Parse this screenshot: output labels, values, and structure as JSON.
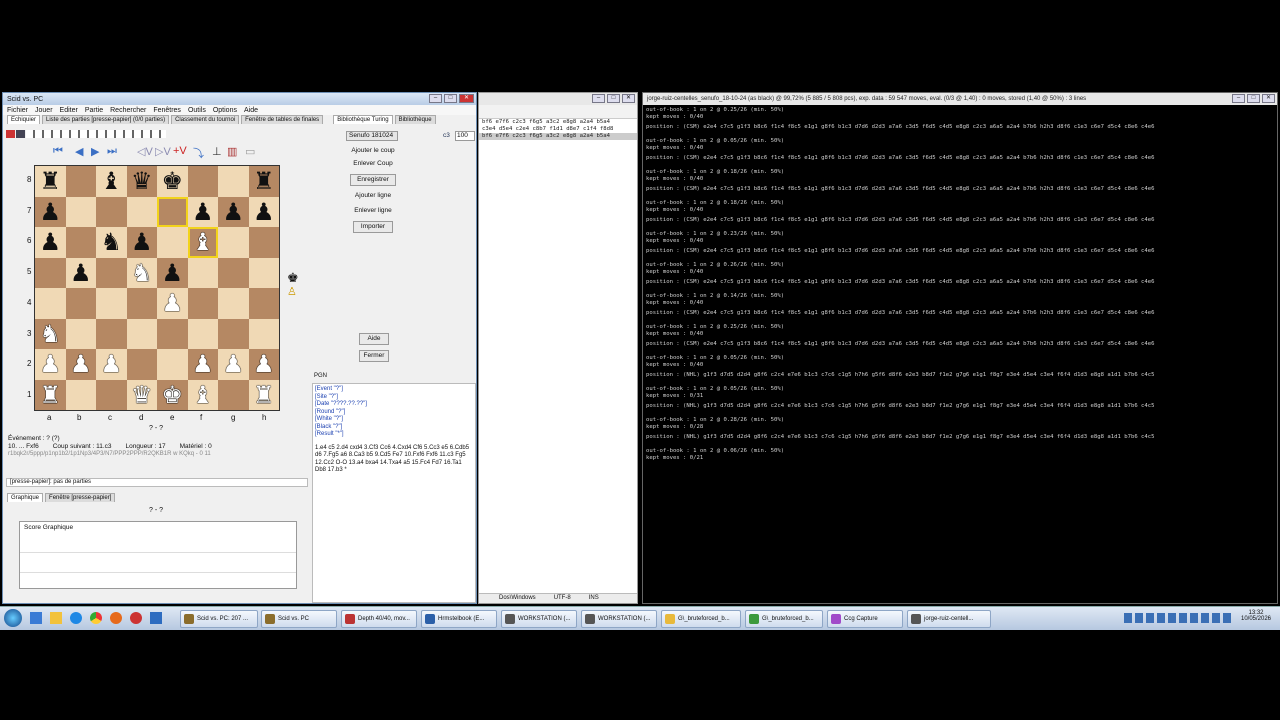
{
  "scid": {
    "title": "Scid vs. PC",
    "menu": [
      "Fichier",
      "Jouer",
      "Editer",
      "Partie",
      "Rechercher",
      "Fenêtres",
      "Outils",
      "Options",
      "Aide"
    ],
    "tabs": [
      "Echiquier",
      "Liste des parties [presse-papier] (0/0 parties)",
      "Classement du tournoi",
      "Fenêtre de tables de finales"
    ],
    "right_tabs": [
      "Bibliothèque Turing",
      "Bibliothèque"
    ],
    "book_select": "Senufo 181024",
    "spin_value": "c3",
    "spin_value2": "100",
    "buttons": {
      "add_move": "Ajouter le coup",
      "remove_move": "Enlever Coup",
      "save": "Enregistrer",
      "add_line": "Ajouter ligne",
      "remove_line": "Enlever ligne",
      "import": "Importer",
      "help": "Aide",
      "close": "Fermer"
    },
    "files": [
      "a",
      "b",
      "c",
      "d",
      "e",
      "f",
      "g",
      "h"
    ],
    "ranks": [
      "8",
      "7",
      "6",
      "5",
      "4",
      "3",
      "2",
      "1"
    ],
    "board": [
      [
        "br",
        "",
        "bb",
        "bq",
        "bk",
        "",
        "",
        "br"
      ],
      [
        "bp",
        "",
        "",
        "",
        "",
        "bp",
        "bp",
        "bp"
      ],
      [
        "bp",
        "",
        "bn",
        "bp",
        "",
        "wb",
        "",
        ""
      ],
      [
        "",
        "bp",
        "",
        "wn",
        "bp",
        "",
        "",
        ""
      ],
      [
        "",
        "",
        "",
        "",
        "wp",
        "",
        "",
        ""
      ],
      [
        "wn",
        "",
        "",
        "",
        "",
        "",
        "",
        ""
      ],
      [
        "wp",
        "wp",
        "wp",
        "",
        "",
        "wp",
        "wp",
        "wp"
      ],
      [
        "wr",
        "",
        "",
        "wq",
        "wk",
        "wb",
        "",
        "wr"
      ]
    ],
    "result_line": "? - ?",
    "info": {
      "event": "Événement : ?  (?)",
      "move": "10. ... Fxf6",
      "next_move": "Coup suivant : 11.c3",
      "length": "Longueur : 17",
      "material": "Matériel : 0",
      "fen": "r1bqk2r/5ppp/p1np1b2/1p1Np3/4P3/N7/PPP2PPP/R2QKB1R w KQkq - 0 11"
    },
    "clipboard": "[presse-papier]: pas de parties",
    "bottom_tabs": [
      "Graphique",
      "Fenêtre [presse-papier]"
    ],
    "graph_result": "? - ?",
    "graph_title": "Score Graphique",
    "pgn_tab": "PGN",
    "pgn_tags": [
      "[Event \"?\"]",
      "[Site \"?\"]",
      "[Date \"????.??.??\"]",
      "[Round \"?\"]",
      "[White \"?\"]",
      "[Black \"?\"]",
      "[Result \"*\"]"
    ],
    "pgn_moves": "1.e4 c5 2.d4 cxd4 3.Cf3 Cc6 4.Cxd4 Cf6 5.Cc3 e5 6.Cdb5 d6 7.Fg5 a6 8.Ca3 b5 9.Cd5 Fe7 10.Fxf6 Fxf6 11.c3 Fg5 12.Cc2 O-O 13.a4 bxa4 14.Txa4 a5 15.Fc4 Fd7 16.Ta1 Db8 17.b3 *"
  },
  "middle": {
    "lines": [
      "bf6 e7f6 c2c3 f6g5 a3c2 e8g8 a2a4 b5a4",
      "c3e4 d5e4 c2e4 c8b7 f1d1 d8e7 c1f4 f8d8",
      "bf6 e7f6 c2c3 f6g5 a3c2 e8g8 a2a4 b5a4"
    ],
    "status": [
      "Dos\\Windows",
      "UTF-8",
      "INS"
    ]
  },
  "console": {
    "title": "jorge-ruiz-centelles_senufo_18-10-24 (as black) @ 99,72% (5 885 / 5 808 pcs), exp. data : 59 547 moves, eval. (0/3 @ 1,40) : 0 moves, stored (1,40 @ 50%) : 3 lines",
    "lines": [
      "out-of-book : 1 on 2 @ 0.25/26 (min. 50%)",
      "kept moves : 0/40",
      "position    : (CSM) e2e4 c7c5 g1f3 b8c6 f1c4 f8c5 e1g1 g8f6 b1c3 d7d6 d2d3 a7a6 c3d5 f6d5 c4d5 e8g8 c2c3 a6a5 a2a4 b7b6 h2h3 d8f6 c1e3 c6e7 d5c4 c8e6 c4e6",
      "out-of-book : 1 on 2 @ 0.05/26 (min. 50%)",
      "kept moves : 0/40",
      "position    : (CSM) e2e4 c7c5 g1f3 b8c6 f1c4 f8c5 e1g1 g8f6 b1c3 d7d6 d2d3 a7a6 c3d5 f6d5 c4d5 e8g8 c2c3 a6a5 a2a4 b7b6 h2h3 d8f6 c1e3 c6e7 d5c4 c8e6 c4e6",
      "out-of-book : 1 on 2 @ 0.18/26 (min. 50%)",
      "kept moves : 0/40",
      "position    : (CSM) e2e4 c7c5 g1f3 b8c6 f1c4 f8c5 e1g1 g8f6 b1c3 d7d6 d2d3 a7a6 c3d5 f6d5 c4d5 e8g8 c2c3 a6a5 a2a4 b7b6 h2h3 d8f6 c1e3 c6e7 d5c4 c8e6 c4e6",
      "out-of-book : 1 on 2 @ 0.18/26 (min. 50%)",
      "kept moves : 0/40",
      "position    : (CSM) e2e4 c7c5 g1f3 b8c6 f1c4 f8c5 e1g1 g8f6 b1c3 d7d6 d2d3 a7a6 c3d5 f6d5 c4d5 e8g8 c2c3 a6a5 a2a4 b7b6 h2h3 d8f6 c1e3 c6e7 d5c4 c8e6 c4e6",
      "out-of-book : 1 on 2 @ 0.23/26 (min. 50%)",
      "kept moves : 0/40",
      "position    : (CSM) e2e4 c7c5 g1f3 b8c6 f1c4 f8c5 e1g1 g8f6 b1c3 d7d6 d2d3 a7a6 c3d5 f6d5 c4d5 e8g8 c2c3 a6a5 a2a4 b7b6 h2h3 d8f6 c1e3 c6e7 d5c4 c8e6 c4e6",
      "out-of-book : 1 on 2 @ 0.26/26 (min. 50%)",
      "kept moves : 0/40",
      "position    : (CSM) e2e4 c7c5 g1f3 b8c6 f1c4 f8c5 e1g1 g8f6 b1c3 d7d6 d2d3 a7a6 c3d5 f6d5 c4d5 e8g8 c2c3 a6a5 a2a4 b7b6 h2h3 d8f6 c1e3 c6e7 d5c4 c8e6 c4e6",
      "out-of-book : 1 on 2 @ 0.14/26 (min. 50%)",
      "kept moves : 0/40",
      "position    : (CSM) e2e4 c7c5 g1f3 b8c6 f1c4 f8c5 e1g1 g8f6 b1c3 d7d6 d2d3 a7a6 c3d5 f6d5 c4d5 e8g8 c2c3 a6a5 a2a4 b7b6 h2h3 d8f6 c1e3 c6e7 d5c4 c8e6 c4e6",
      "out-of-book : 1 on 2 @ 0.25/26 (min. 50%)",
      "kept moves : 0/40",
      "position    : (CSM) e2e4 c7c5 g1f3 b8c6 f1c4 f8c5 e1g1 g8f6 b1c3 d7d6 d2d3 a7a6 c3d5 f6d5 c4d5 e8g8 c2c3 a6a5 a2a4 b7b6 h2h3 d8f6 c1e3 c6e7 d5c4 c8e6 c4e6",
      "out-of-book : 1 on 2 @ 0.05/26 (min. 50%)",
      "kept moves : 0/40",
      "position    : (NHL) g1f3 d7d5 d2d4 g8f6 c2c4 e7e6 b1c3 c7c6 c1g5 h7h6 g5f6 d8f6 e2e3 b8d7 f1e2 g7g6 e1g1 f8g7 e3e4 d5e4 c3e4 f6f4 d1d3 e8g8 a1d1 b7b6 c4c5",
      "out-of-book : 1 on 2 @ 0.05/26 (min. 50%)",
      "kept moves : 0/31",
      "position    : (NHL) g1f3 d7d5 d2d4 g8f6 c2c4 e7e6 b1c3 c7c6 c1g5 h7h6 g5f6 d8f6 e2e3 b8d7 f1e2 g7g6 e1g1 f8g7 e3e4 d5e4 c3e4 f6f4 d1d3 e8g8 a1d1 b7b6 c4c5",
      "out-of-book : 1 on 2 @ 0.28/26 (min. 50%)",
      "kept moves : 0/28",
      "position    : (NHL) g1f3 d7d5 d2d4 g8f6 c2c4 e7e6 b1c3 c7c6 c1g5 h7h6 g5f6 d8f6 e2e3 b8d7 f1e2 g7g6 e1g1 f8g7 e3e4 d5e4 c3e4 f6f4 d1d3 e8g8 a1d1 b7b6 c4c5",
      "out-of-book : 1 on 2 @ 0.06/26 (min. 50%)",
      "kept moves : 0/21"
    ]
  },
  "taskbar": {
    "items": [
      "Scid vs. PC: 207 ...",
      "Scid vs. PC",
      "Depth 40/40, mov...",
      "Hrmstelbook (E...",
      "WORKSTATION (...",
      "WORKSTATION (...",
      "G\\_bruteforced_b...",
      "G\\_bruteforced_b...",
      "Ccg Capture",
      "jorge-ruiz-centell..."
    ],
    "time": "13:32",
    "date": "10/05/2026"
  }
}
